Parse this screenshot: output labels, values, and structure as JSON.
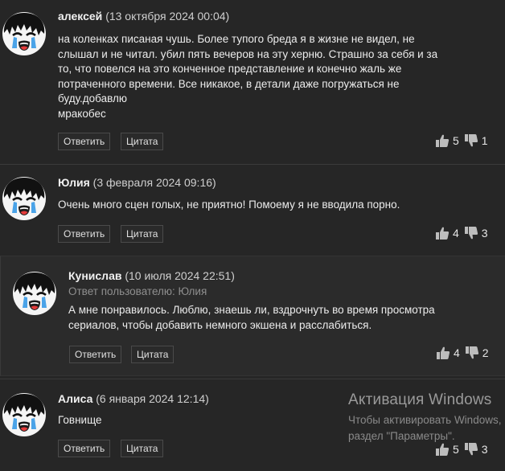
{
  "comments": [
    {
      "author": "алексей",
      "date": "(13 октября 2024 00:04)",
      "text": "на коленках писаная чушь. Более тупого бреда я в жизне не видел, не\nслышал и не читал. убил пять вечеров на эту херню. Страшно за себя и за\nто, что повелся на это конченное представление и конечно жаль же\nпотраченного времени. Все никакое, в детали даже погружаться не\nбуду.добавлю\nмракобес",
      "reply_label": "Ответить",
      "quote_label": "Цитата",
      "likes": "5",
      "dislikes": "1"
    },
    {
      "author": "Юлия",
      "date": "(3 февраля 2024 09:16)",
      "text": "Очень много сцен голых, не приятно! Помоему я не вводила порно.",
      "reply_label": "Ответить",
      "quote_label": "Цитата",
      "likes": "4",
      "dislikes": "3"
    },
    {
      "author": "Кунислав",
      "date": "(10 июля 2024 22:51)",
      "reply_to": "Ответ пользователю: Юлия",
      "text": "А мне понравилось. Люблю, знаешь ли, вздрочнуть во время просмотра\nсериалов, чтобы добавить немного экшена и расслабиться.",
      "reply_label": "Ответить",
      "quote_label": "Цитата",
      "likes": "4",
      "dislikes": "2"
    },
    {
      "author": "Алиса",
      "date": "(6 января 2024 12:14)",
      "text": "Говнище",
      "reply_label": "Ответить",
      "quote_label": "Цитата",
      "likes": "5",
      "dislikes": "3"
    }
  ],
  "watermark": {
    "title": "Активация Windows",
    "line1": "Чтобы активировать Windows,",
    "line2": "раздел \"Параметры\"."
  },
  "icons": {
    "avatar": "crying-cartoon-avatar-icon",
    "like": "thumbs-up-icon",
    "dislike": "thumbs-down-icon"
  },
  "colors": {
    "background": "#262626",
    "reply_background": "#2b2b2b",
    "text": "#ececec",
    "muted": "#8f8f8f"
  }
}
